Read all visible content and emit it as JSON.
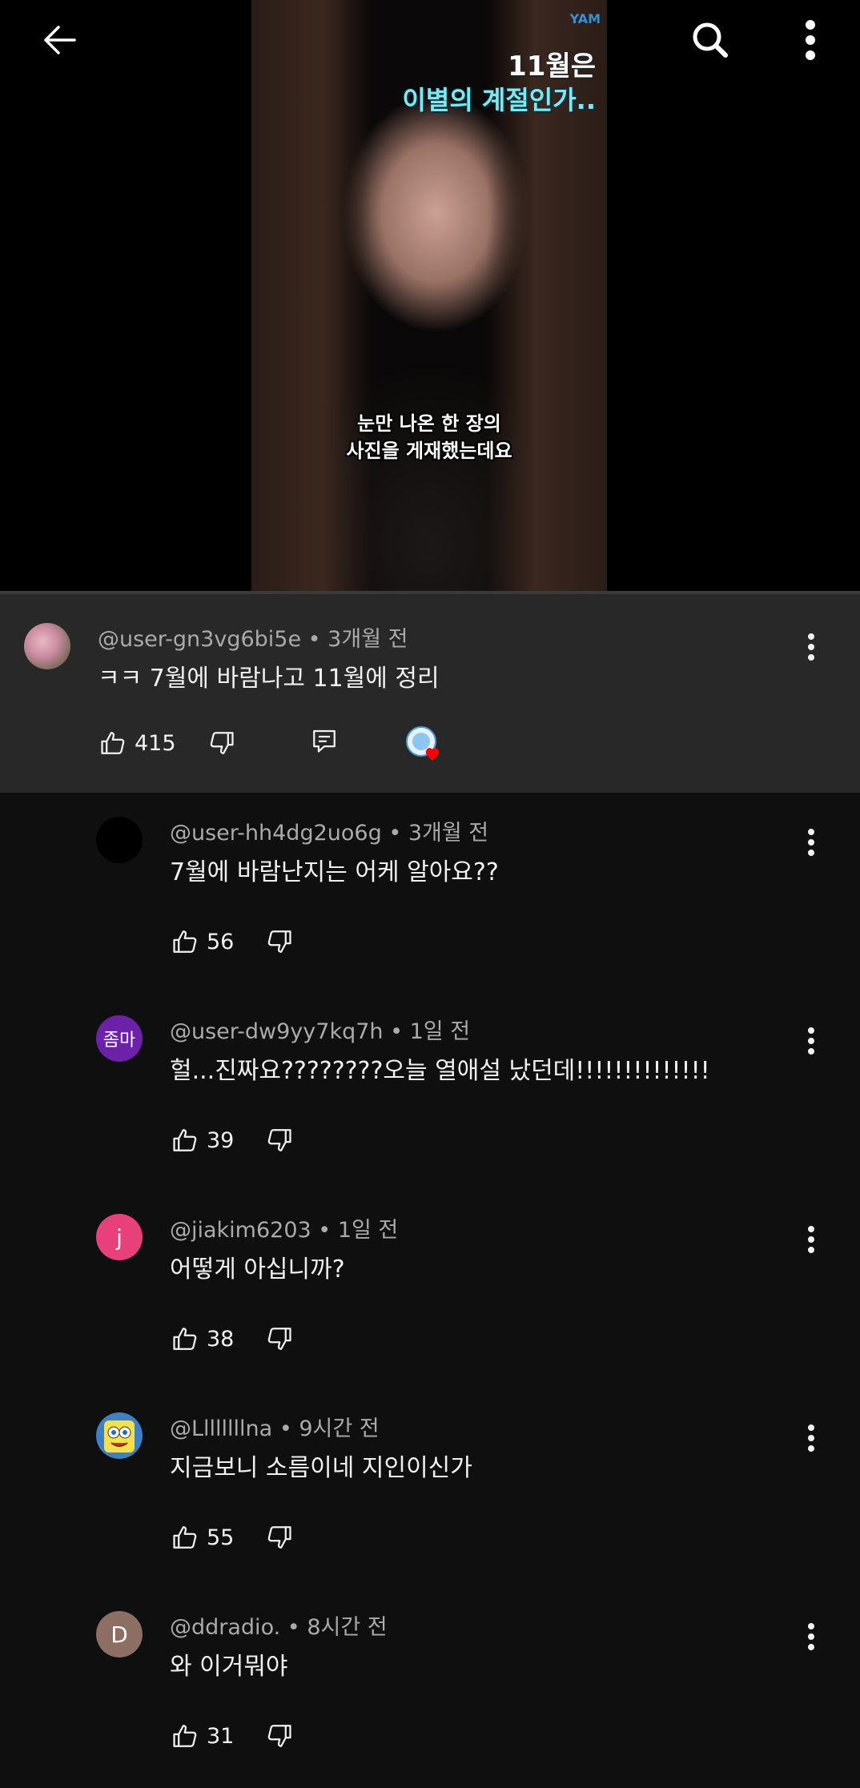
{
  "video": {
    "brand": "YAM",
    "title_line1": "11월은",
    "title_line2": "이별의 계절인가..",
    "subtitle_line1": "눈만 나온 한 장의",
    "subtitle_line2": "사진을 게재했는데요"
  },
  "icons": {
    "back": "back-arrow-icon",
    "search": "search-icon",
    "more": "more-vertical-icon",
    "like": "thumbs-up-icon",
    "dislike": "thumbs-down-icon",
    "reply": "reply-icon"
  },
  "colors": {
    "background": "#0f0f0f",
    "highlight": "#282828",
    "meta_text": "#aaaaaa",
    "heart": "#ff0000"
  },
  "comments": [
    {
      "user": "@user-gn3vg6bi5e",
      "time": "3개월 전",
      "text": "ㅋㅋ 7월에 바람나고 11월에 정리",
      "likes": "415",
      "avatar_text": ""
    },
    {
      "user": "@user-hh4dg2uo6g",
      "time": "3개월 전",
      "text": "7월에 바람난지는 어케 알아요??",
      "likes": "56",
      "avatar_text": ""
    },
    {
      "user": "@user-dw9yy7kq7h",
      "time": "1일 전",
      "text": "헐...진짜요????????오늘 열애설 났던데!!!!!!!!!!!!!!",
      "likes": "39",
      "avatar_text": "좀마"
    },
    {
      "user": "@jiakim6203",
      "time": "1일 전",
      "text": "어떻게 아십니까?",
      "likes": "38",
      "avatar_text": "j"
    },
    {
      "user": "@Llllllllna",
      "time": "9시간 전",
      "text": "지금보니 소름이네 지인이신가",
      "likes": "55",
      "avatar_text": ""
    },
    {
      "user": "@ddradio.",
      "time": "8시간 전",
      "text": "와 이거뭐야",
      "likes": "31",
      "avatar_text": "D"
    }
  ]
}
